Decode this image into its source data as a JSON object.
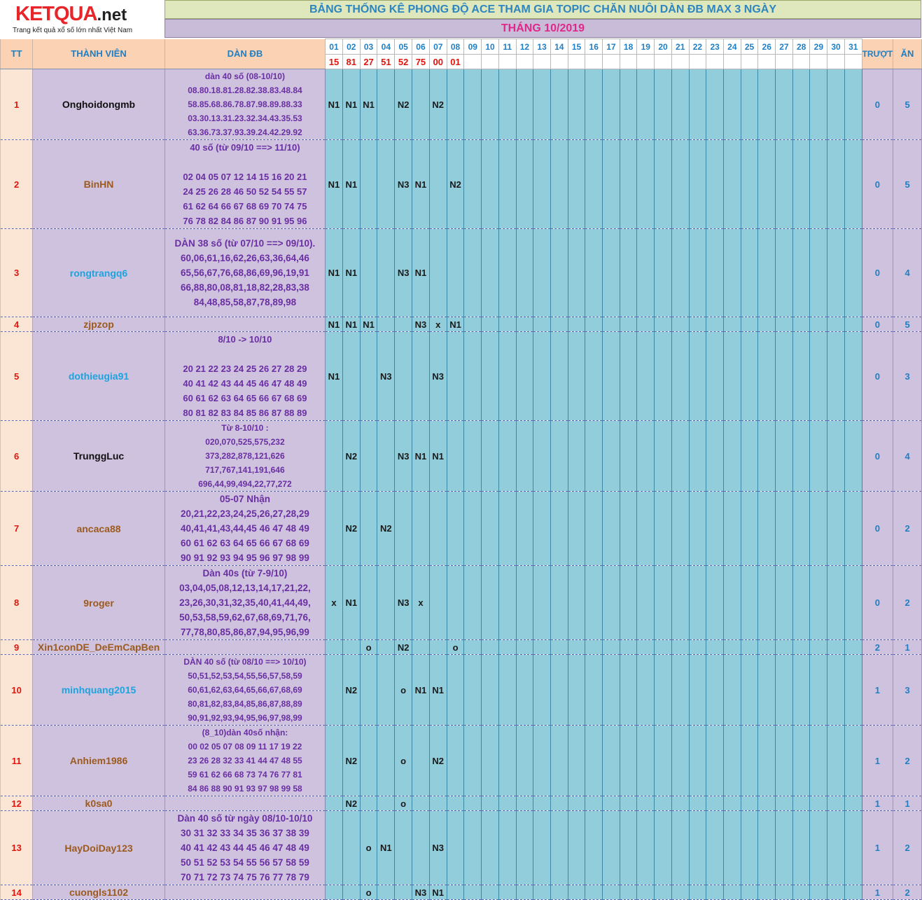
{
  "logo": {
    "brand": "KETQUA",
    "suffix": ".net",
    "tagline": "Trang kết quả xổ số lớn nhất Việt Nam"
  },
  "title": "BẢNG THỐNG KÊ PHONG ĐỘ ACE THAM GIA TOPIC CHĂN NUÔI DÀN ĐB MAX 3 NGÀY",
  "month": "THÁNG 10/2019",
  "headers": {
    "tt": "TT",
    "member": "THÀNH VIÊN",
    "dan": "DÀN ĐB",
    "miss": "TRƯỢT",
    "win": "ĂN"
  },
  "days": [
    "01",
    "02",
    "03",
    "04",
    "05",
    "06",
    "07",
    "08",
    "09",
    "10",
    "11",
    "12",
    "13",
    "14",
    "15",
    "16",
    "17",
    "18",
    "19",
    "20",
    "21",
    "22",
    "23",
    "24",
    "25",
    "26",
    "27",
    "28",
    "29",
    "30",
    "31"
  ],
  "results": [
    "15",
    "81",
    "27",
    "51",
    "52",
    "75",
    "00",
    "01"
  ],
  "colors": {
    "brown": "#9c5a1e",
    "blue": "#1ea3df",
    "black": "#111111",
    "header_bg": "#fbd2b4",
    "member_bg": "#cfc2de",
    "day_bg": "#92cddb",
    "result_red": "#e0150d"
  },
  "rows": [
    {
      "tt": "1",
      "name": "Onghoidongmb",
      "color": "black",
      "dan": [
        "dàn 40 số (08-10/10)",
        "08.80.18.81.28.82.38.83.48.84",
        "58.85.68.86.78.87.98.89.88.33",
        "03.30.13.31.23.32.34.43.35.53",
        "63.36.73.37.93.39.24.42.29.92"
      ],
      "marks": {
        "01": "N1",
        "02": "N1",
        "03": "N1",
        "05": "N2",
        "07": "N2"
      },
      "miss": "0",
      "win": "5"
    },
    {
      "tt": "2",
      "name": "BinHN",
      "color": "brown",
      "dan": [
        "40 số (từ 09/10 ==> 11/10)",
        "",
        "02 04 05 07 12 14 15 16 20 21",
        "24 25 26 28 46 50 52 54 55 57",
        "61 62 64 66 67 68 69 70 74 75",
        "76 78 82 84 86 87 90 91 95 96"
      ],
      "marks": {
        "01": "N1",
        "02": "N1",
        "05": "N3",
        "06": "N1",
        "08": "N2"
      },
      "miss": "0",
      "win": "5"
    },
    {
      "tt": "3",
      "name": "rongtrangq6",
      "color": "blue",
      "dan": [
        "DÀN 38 số (từ 07/10 ==> 09/10).",
        "60,06,61,16,62,26,63,36,64,46",
        "65,56,67,76,68,86,69,96,19,91",
        "66,88,80,08,81,18,82,28,83,38",
        "84,48,85,58,87,78,89,98"
      ],
      "marks": {
        "01": "N1",
        "02": "N1",
        "05": "N3",
        "06": "N1"
      },
      "miss": "0",
      "win": "4"
    },
    {
      "tt": "4",
      "name": "zjpzop",
      "color": "brown",
      "dan": [],
      "marks": {
        "01": "N1",
        "02": "N1",
        "03": "N1",
        "06": "N3",
        "07": "x",
        "08": "N1"
      },
      "miss": "0",
      "win": "5"
    },
    {
      "tt": "5",
      "name": "dothieugia91",
      "color": "blue",
      "dan": [
        "8/10 -> 10/10",
        "",
        "20 21 22 23 24 25 26 27 28 29",
        "40 41 42 43 44 45 46 47 48 49",
        "60 61 62 63 64 65 66 67 68 69",
        "80 81 82 83 84 85 86 87 88 89"
      ],
      "marks": {
        "01": "N1",
        "04": "N3",
        "07": "N3"
      },
      "miss": "0",
      "win": "3"
    },
    {
      "tt": "6",
      "name": "TrunggLuc",
      "color": "black",
      "dan": [
        "Từ 8-10/10 :",
        "020,070,525,575,232",
        "373,282,878,121,626",
        "717,767,141,191,646",
        "696,44,99,494,22,77,272"
      ],
      "marks": {
        "02": "N2",
        "05": "N3",
        "06": "N1",
        "07": "N1"
      },
      "miss": "0",
      "win": "4"
    },
    {
      "tt": "7",
      "name": "ancaca88",
      "color": "brown",
      "dan": [
        "05-07 Nhận",
        "20,21,22,23,24,25,26,27,28,29",
        "40,41,41,43,44,45 46 47 48 49",
        "60 61 62 63 64 65 66 67 68 69",
        "90 91 92 93 94 95 96 97 98 99"
      ],
      "marks": {
        "02": "N2",
        "04": "N2"
      },
      "miss": "0",
      "win": "2"
    },
    {
      "tt": "8",
      "name": "9roger",
      "color": "brown",
      "dan": [
        "Dàn 40s (từ 7-9/10)",
        "03,04,05,08,12,13,14,17,21,22,",
        "23,26,30,31,32,35,40,41,44,49,",
        "50,53,58,59,62,67,68,69,71,76,",
        "77,78,80,85,86,87,94,95,96,99"
      ],
      "marks": {
        "01": "x",
        "02": "N1",
        "05": "N3",
        "06": "x"
      },
      "miss": "0",
      "win": "2"
    },
    {
      "tt": "9",
      "name": "Xin1conDE_DeEmCapBen",
      "color": "brown",
      "dan": [],
      "marks": {
        "03": "o",
        "05": "N2",
        "08": "o"
      },
      "miss": "2",
      "win": "1"
    },
    {
      "tt": "10",
      "name": "minhquang2015",
      "color": "blue",
      "dan": [
        "DÀN 40 số (từ 08/10 ==> 10/10)",
        "50,51,52,53,54,55,56,57,58,59",
        "60,61,62,63,64,65,66,67,68,69",
        "80,81,82,83,84,85,86,87,88,89",
        "90,91,92,93,94,95,96,97,98,99"
      ],
      "marks": {
        "02": "N2",
        "05": "o",
        "06": "N1",
        "07": "N1"
      },
      "miss": "1",
      "win": "3"
    },
    {
      "tt": "11",
      "name": "Anhiem1986",
      "color": "brown",
      "dan": [
        "(8_10)dàn 40số nhận:",
        "00 02 05 07 08 09 11 17 19 22",
        "23 26 28 32 33 41 44 47 48 55",
        "59 61 62 66 68 73 74 76 77 81",
        "84 86 88 90 91 93 97 98 99 58"
      ],
      "marks": {
        "02": "N2",
        "05": "o",
        "07": "N2"
      },
      "miss": "1",
      "win": "2"
    },
    {
      "tt": "12",
      "name": "k0sa0",
      "color": "brown",
      "dan": [],
      "marks": {
        "02": "N2",
        "05": "o"
      },
      "miss": "1",
      "win": "1"
    },
    {
      "tt": "13",
      "name": "HayDoiDay123",
      "color": "brown",
      "dan": [
        "Dàn 40 số từ ngày 08/10-10/10",
        "30 31 32 33 34 35 36 37 38 39",
        "40 41 42 43 44 45 46 47 48 49",
        "50 51 52 53 54 55 56 57 58 59",
        "70 71 72 73 74 75 76 77 78 79"
      ],
      "marks": {
        "03": "o",
        "04": "N1",
        "07": "N3"
      },
      "miss": "1",
      "win": "2"
    },
    {
      "tt": "14",
      "name": "cuongls1102",
      "color": "brown",
      "dan": [],
      "marks": {
        "03": "o",
        "06": "N3",
        "07": "N1"
      },
      "miss": "1",
      "win": "2"
    }
  ]
}
